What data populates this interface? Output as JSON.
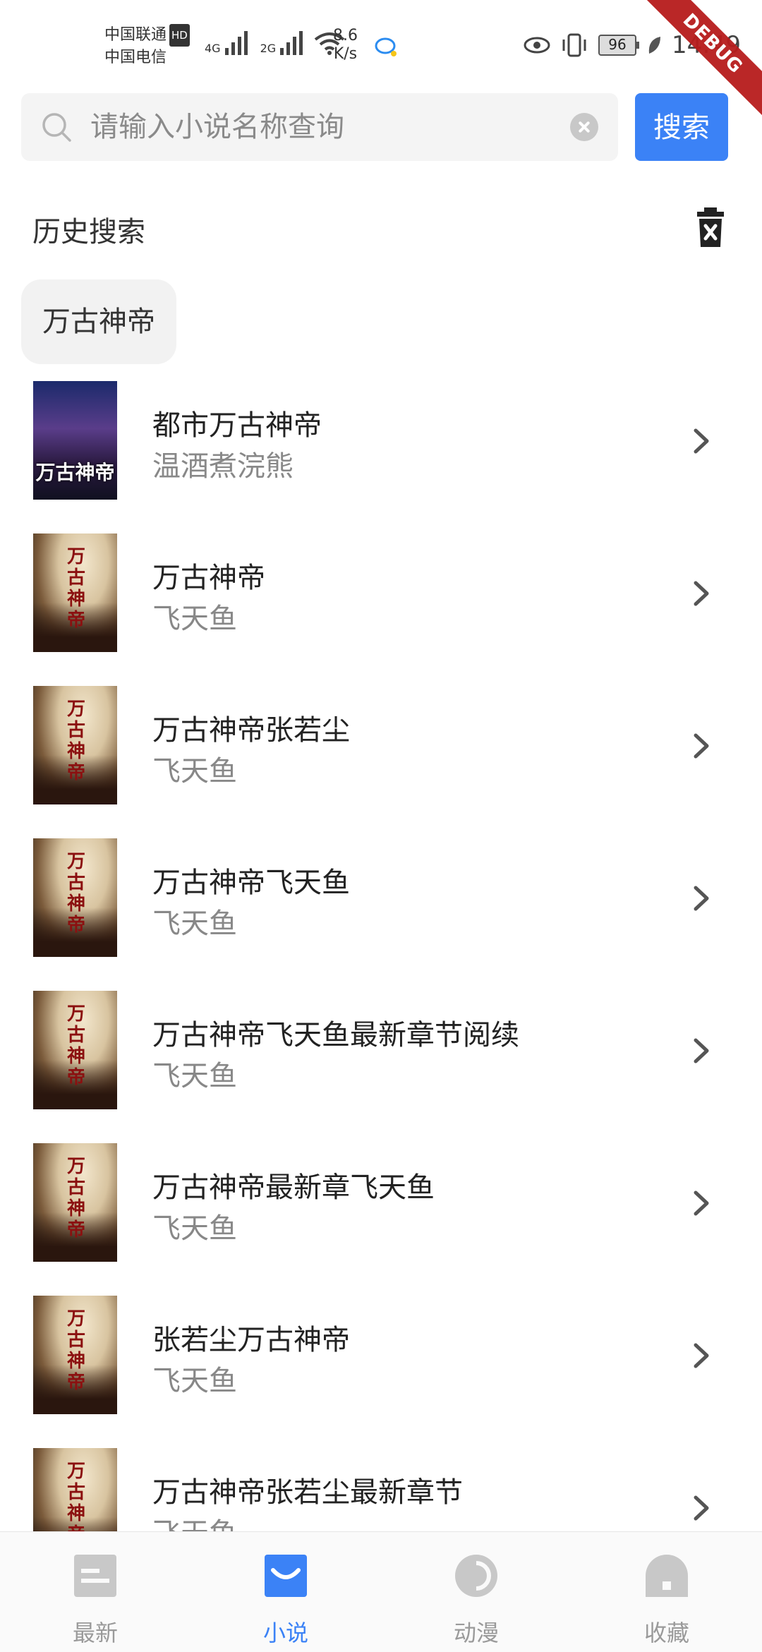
{
  "status_bar": {
    "carrier1": "中国联通",
    "carrier2": "中国电信",
    "hd": "HD",
    "net1": "4G",
    "net2": "2G",
    "speed_value": "8.6",
    "speed_unit": "K/s",
    "battery": "96",
    "time": "14:49",
    "debug": "DEBUG"
  },
  "search": {
    "placeholder": "请输入小说名称查询",
    "button_label": "搜索"
  },
  "history": {
    "title": "历史搜索",
    "items": [
      "万古神帝"
    ]
  },
  "results": [
    {
      "title": "都市万古神帝",
      "author": "温酒煮浣熊",
      "cover": "purple-cover",
      "cover_text": "万古神帝"
    },
    {
      "title": "万古神帝",
      "author": "飞天鱼",
      "cover": "ink-cover",
      "cover_text": "万古神帝"
    },
    {
      "title": "万古神帝张若尘",
      "author": "飞天鱼",
      "cover": "ink-cover",
      "cover_text": "万古神帝"
    },
    {
      "title": "万古神帝飞天鱼",
      "author": "飞天鱼",
      "cover": "ink-cover",
      "cover_text": "万古神帝"
    },
    {
      "title": "万古神帝飞天鱼最新章节阅续",
      "author": "飞天鱼",
      "cover": "ink-cover",
      "cover_text": "万古神帝"
    },
    {
      "title": "万古神帝最新章飞天鱼",
      "author": "飞天鱼",
      "cover": "ink-cover",
      "cover_text": "万古神帝"
    },
    {
      "title": "张若尘万古神帝",
      "author": "飞天鱼",
      "cover": "ink-cover",
      "cover_text": "万古神帝"
    },
    {
      "title": "万古神帝张若尘最新章节",
      "author": "飞天鱼",
      "cover": "ink-cover",
      "cover_text": "万古神帝"
    }
  ],
  "bottom_nav": [
    {
      "label": "最新",
      "icon": "latest-icon",
      "active": false
    },
    {
      "label": "小说",
      "icon": "novel-icon",
      "active": true
    },
    {
      "label": "动漫",
      "icon": "anime-icon",
      "active": false
    },
    {
      "label": "收藏",
      "icon": "favorites-icon",
      "active": false
    }
  ],
  "colors": {
    "accent": "#3b82f6",
    "inactive_nav": "#c8c8c8",
    "debug_ribbon": "#b71c1c"
  }
}
